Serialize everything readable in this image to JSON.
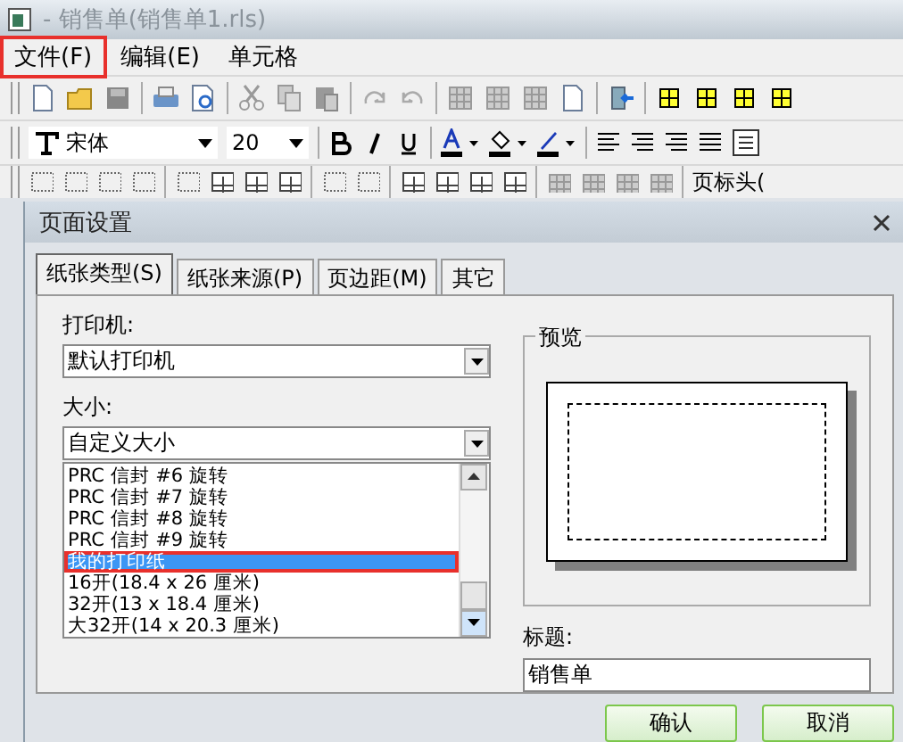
{
  "window": {
    "title": "- 销售单(销售单1.rls)"
  },
  "menu": [
    {
      "label": "文件(F)",
      "highlighted": true
    },
    {
      "label": "编辑(E)",
      "highlighted": false
    },
    {
      "label": "单元格",
      "highlighted": false
    }
  ],
  "format_toolbar": {
    "font": "宋体",
    "size": "20"
  },
  "layout_toolbar": {
    "label": "页标头("
  },
  "dialog": {
    "title": "页面设置",
    "tabs": [
      {
        "label": "纸张类型(S)",
        "selected": true
      },
      {
        "label": "纸张来源(P)",
        "selected": false
      },
      {
        "label": "页边距(M)",
        "selected": false
      },
      {
        "label": "其它",
        "selected": false
      }
    ],
    "printer": {
      "label": "打印机:",
      "value": "默认打印机"
    },
    "size": {
      "label": "大小:",
      "value": "自定义大小",
      "options": [
        {
          "label": "PRC 信封 #6 旋转",
          "selected": false,
          "highlighted": false
        },
        {
          "label": "PRC 信封 #7 旋转",
          "selected": false,
          "highlighted": false
        },
        {
          "label": "PRC 信封 #8 旋转",
          "selected": false,
          "highlighted": false
        },
        {
          "label": "PRC 信封 #9 旋转",
          "selected": false,
          "highlighted": false
        },
        {
          "label": "我的打印纸",
          "selected": true,
          "highlighted": true
        },
        {
          "label": "16开(18.4 x 26 厘米)",
          "selected": false,
          "highlighted": false
        },
        {
          "label": "32开(13 x 18.4 厘米)",
          "selected": false,
          "highlighted": false
        },
        {
          "label": "大32开(14 x 20.3 厘米)",
          "selected": false,
          "highlighted": false
        }
      ]
    },
    "preview": {
      "label": "预览"
    },
    "caption": {
      "label": "标题:",
      "value": "销售单"
    },
    "buttons": [
      "确认",
      "取消"
    ]
  }
}
